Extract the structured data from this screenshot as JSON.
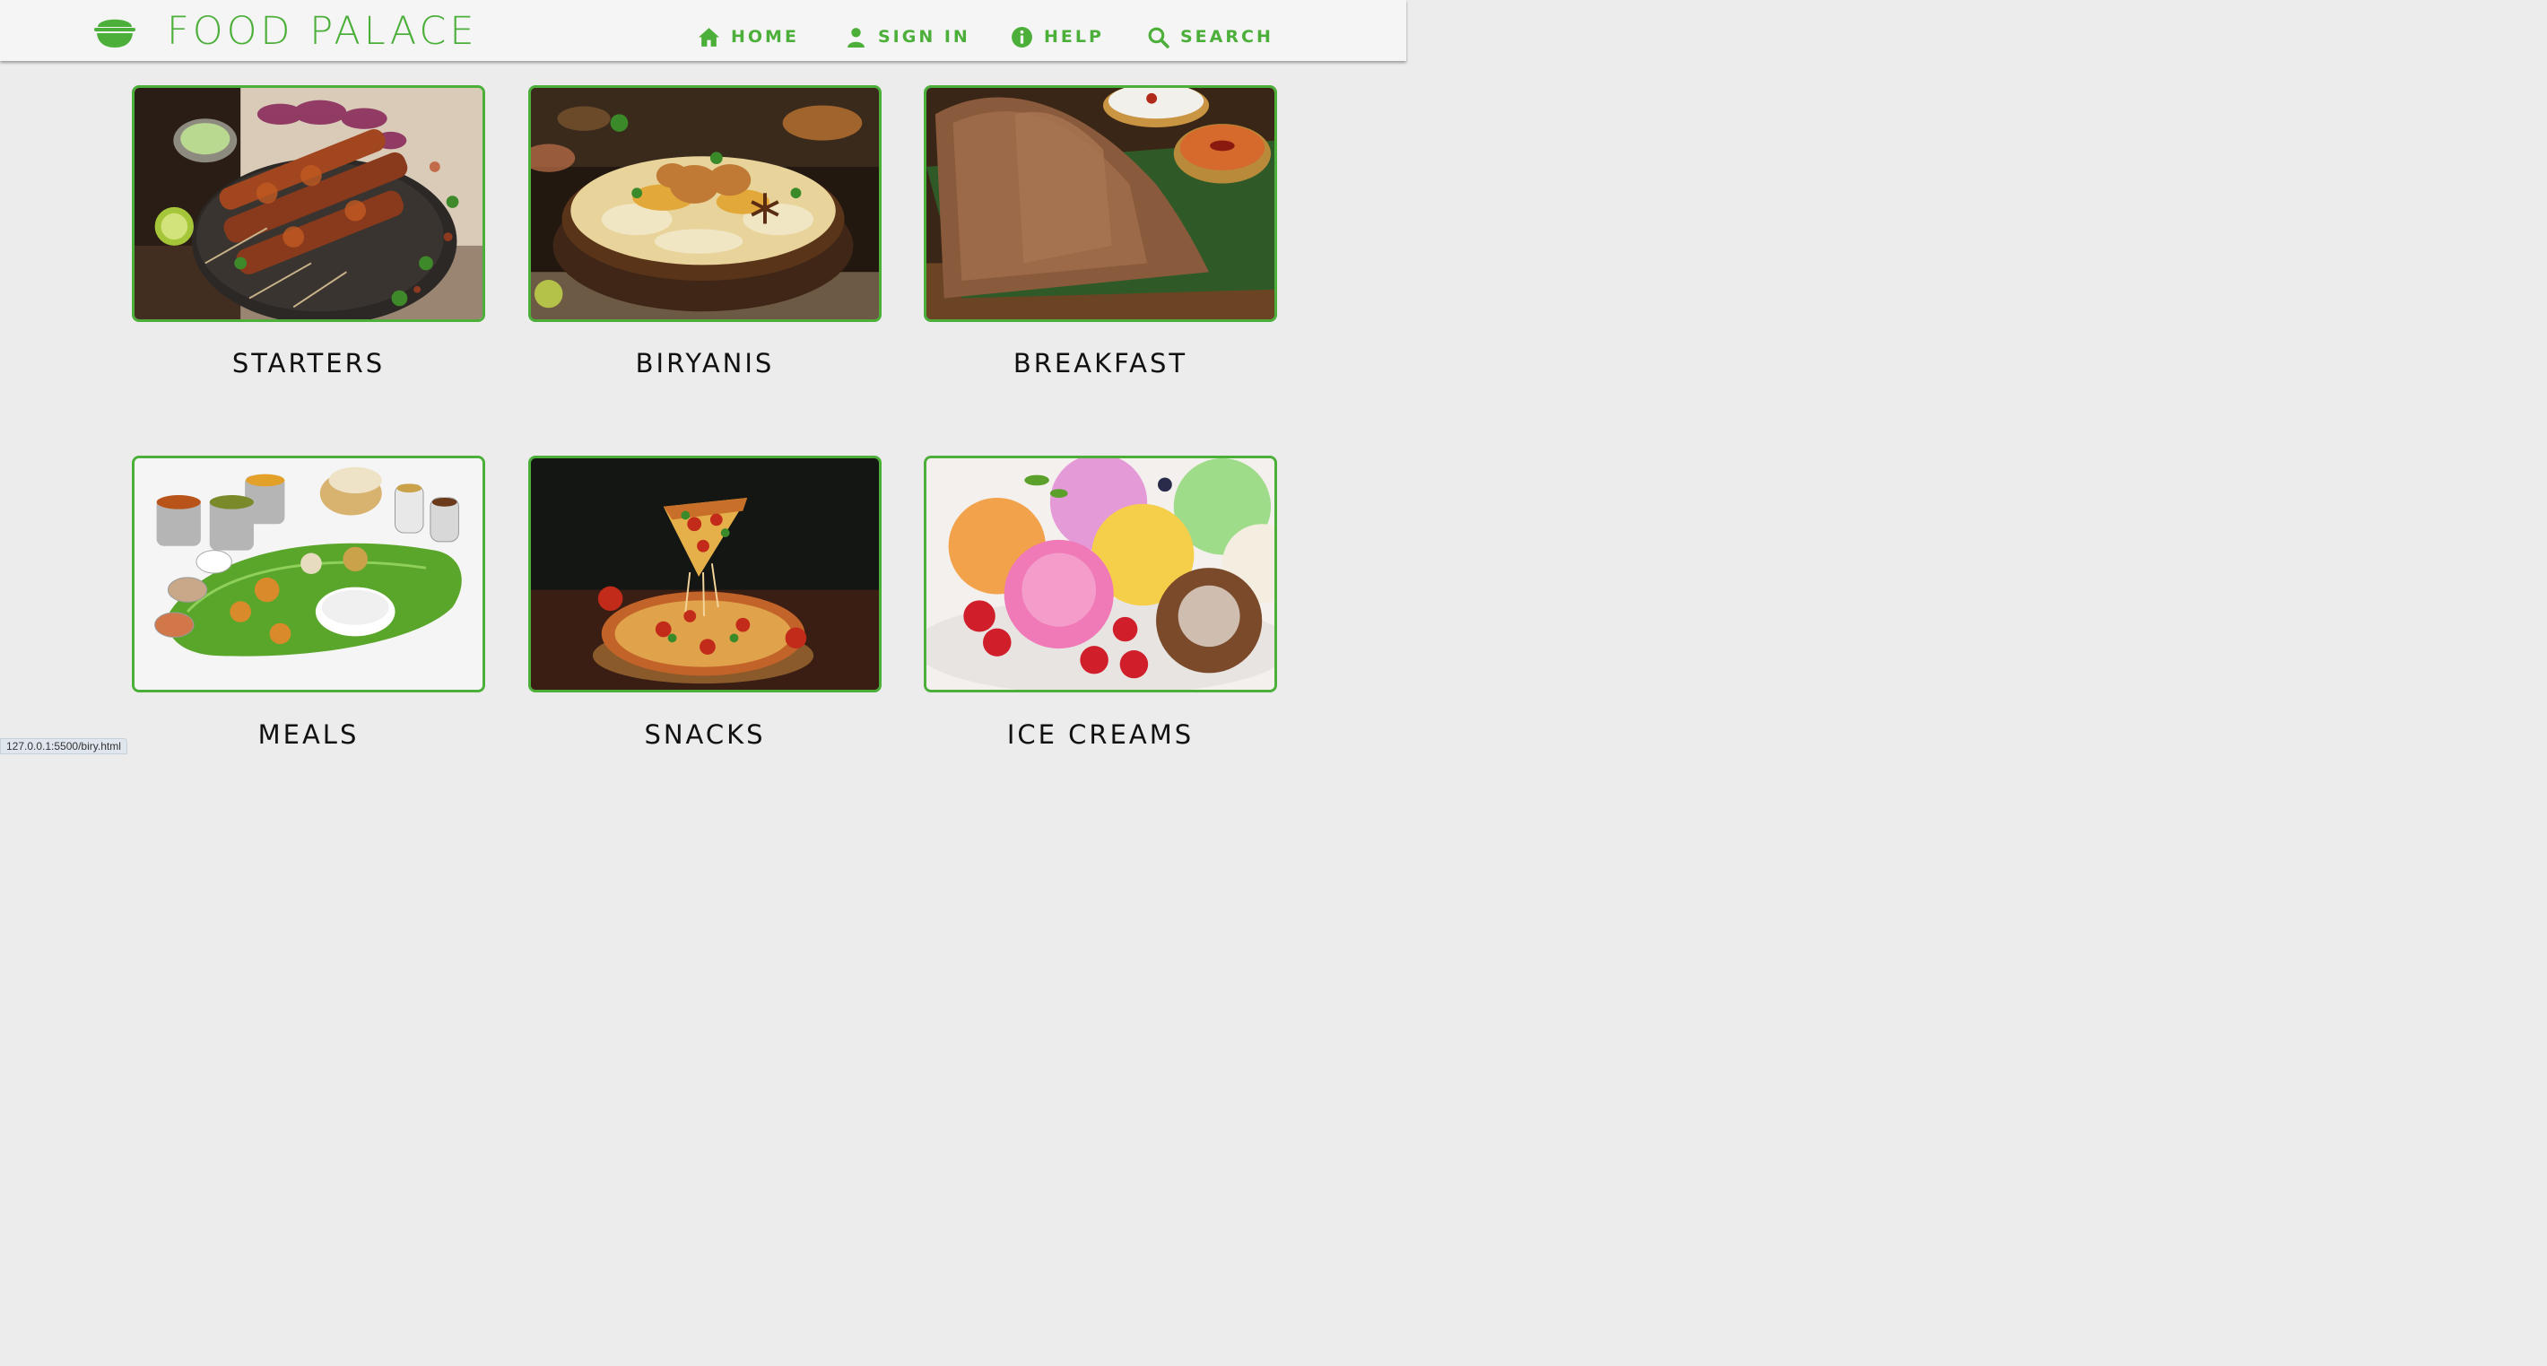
{
  "brand": {
    "name": "FOOD PALACE",
    "color": "#4caf3a"
  },
  "nav": [
    {
      "icon": "home-icon",
      "label": "HOME"
    },
    {
      "icon": "user-icon",
      "label": "SIGN IN"
    },
    {
      "icon": "info-icon",
      "label": "HELP"
    },
    {
      "icon": "search-icon",
      "label": "SEARCH"
    }
  ],
  "categories": [
    {
      "label": "STARTERS"
    },
    {
      "label": "BIRYANIS"
    },
    {
      "label": "BREAKFAST"
    },
    {
      "label": "MEALS"
    },
    {
      "label": "SNACKS"
    },
    {
      "label": "ICE CREAMS"
    }
  ],
  "status_url": "127.0.0.1:5500/biry.html"
}
